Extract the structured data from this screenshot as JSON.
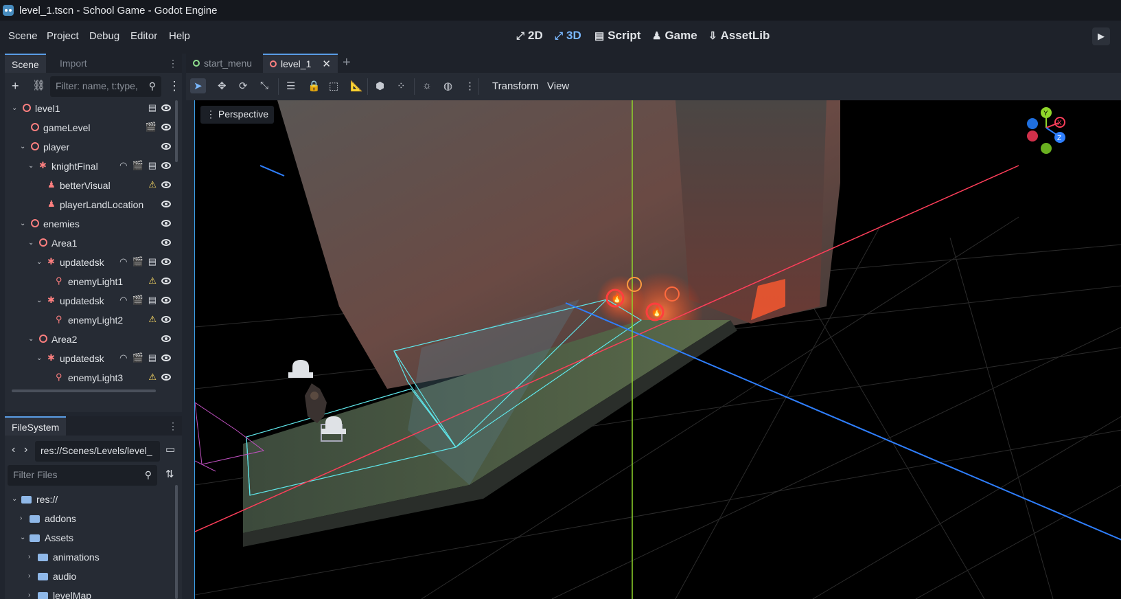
{
  "window": {
    "title": "level_1.tscn - School Game - Godot Engine"
  },
  "menu": [
    "Scene",
    "Project",
    "Debug",
    "Editor",
    "Help"
  ],
  "workspaces": [
    {
      "label": "2D",
      "icon": "2d-icon"
    },
    {
      "label": "3D",
      "icon": "3d-icon",
      "active": true
    },
    {
      "label": "Script",
      "icon": "script-icon"
    },
    {
      "label": "Game",
      "icon": "game-icon"
    },
    {
      "label": "AssetLib",
      "icon": "assetlib-icon"
    }
  ],
  "scene_dock": {
    "tabs": [
      "Scene",
      "Import"
    ],
    "filter_placeholder": "Filter: name, t:type,",
    "tree": [
      {
        "label": "level1",
        "icon": "node3d"
      },
      {
        "label": "gameLevel",
        "icon": "node3d"
      },
      {
        "label": "player",
        "icon": "node3d"
      },
      {
        "label": "knightFinal",
        "icon": "body"
      },
      {
        "label": "betterVisual",
        "icon": "light"
      },
      {
        "label": "playerLandLocation",
        "icon": "light"
      },
      {
        "label": "enemies",
        "icon": "node3d"
      },
      {
        "label": "Area1",
        "icon": "node3d"
      },
      {
        "label": "updatedsk",
        "icon": "body"
      },
      {
        "label": "enemyLight1",
        "icon": "light"
      },
      {
        "label": "updatedsk",
        "icon": "body"
      },
      {
        "label": "enemyLight2",
        "icon": "light"
      },
      {
        "label": "Area2",
        "icon": "node3d"
      },
      {
        "label": "updatedsk",
        "icon": "body"
      },
      {
        "label": "enemyLight3",
        "icon": "light"
      }
    ]
  },
  "filesystem_dock": {
    "tab": "FileSystem",
    "path": "res://Scenes/Levels/level_",
    "filter_placeholder": "Filter Files",
    "tree": [
      {
        "label": "res://"
      },
      {
        "label": "addons"
      },
      {
        "label": "Assets"
      },
      {
        "label": "animations"
      },
      {
        "label": "audio"
      },
      {
        "label": "levelMap"
      }
    ]
  },
  "scene_tabs": [
    {
      "label": "start_menu",
      "active": false
    },
    {
      "label": "level_1",
      "active": true
    }
  ],
  "viewport_toolbar": {
    "transform_label": "Transform",
    "view_label": "View"
  },
  "viewport": {
    "view_mode": "Perspective",
    "gizmo_axes": [
      "Y",
      "X",
      "Z"
    ],
    "colors": {
      "x_axis": "#ff3e5a",
      "y_axis": "#8fd62a",
      "z_axis": "#2f7fff",
      "accent": "#5a9de6"
    }
  }
}
